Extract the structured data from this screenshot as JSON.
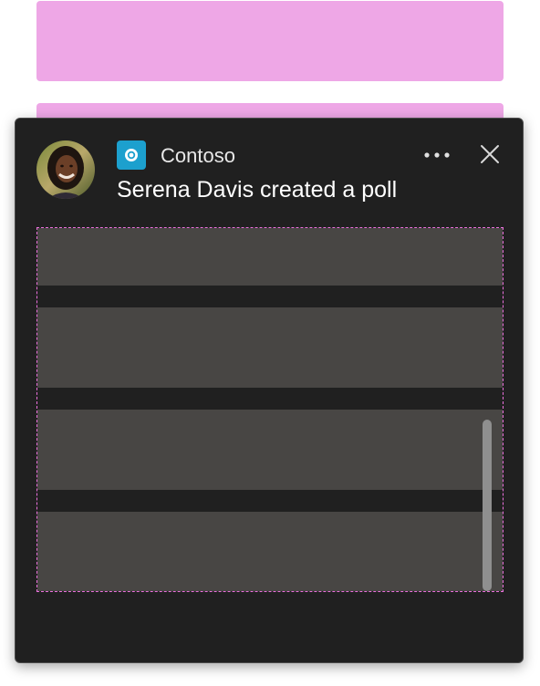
{
  "notification": {
    "app_name": "Contoso",
    "title": "Serena Davis created a poll",
    "avatar_name": "Serena Davis",
    "app_icon": "contoso-app-icon",
    "more_icon": "more-horizontal-icon",
    "close_icon": "close-icon"
  },
  "colors": {
    "placeholder": "#eea7e6",
    "card_background": "#202020",
    "row_background": "#484644",
    "app_icon_background": "#1ca0ce",
    "content_outline": "#ea6fdc"
  }
}
